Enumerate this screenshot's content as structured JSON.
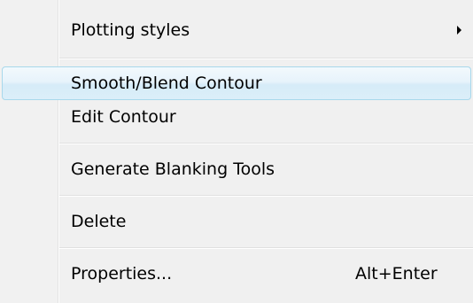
{
  "menu": {
    "items": [
      {
        "label": "Plotting styles",
        "has_submenu": true
      },
      {
        "label": "Smooth/Blend Contour",
        "highlighted": true
      },
      {
        "label": "Edit Contour"
      },
      {
        "label": "Generate Blanking Tools"
      },
      {
        "label": "Delete"
      },
      {
        "label": "Properties...",
        "shortcut": "Alt+Enter"
      }
    ]
  },
  "colors": {
    "menu_background": "#f0f0f0",
    "highlight_border": "#a8d8eb",
    "highlight_fill": "#dbeef9",
    "separator": "#e0e0e0",
    "text": "#000000"
  },
  "icons": {
    "submenu_arrow": "triangle-right"
  }
}
